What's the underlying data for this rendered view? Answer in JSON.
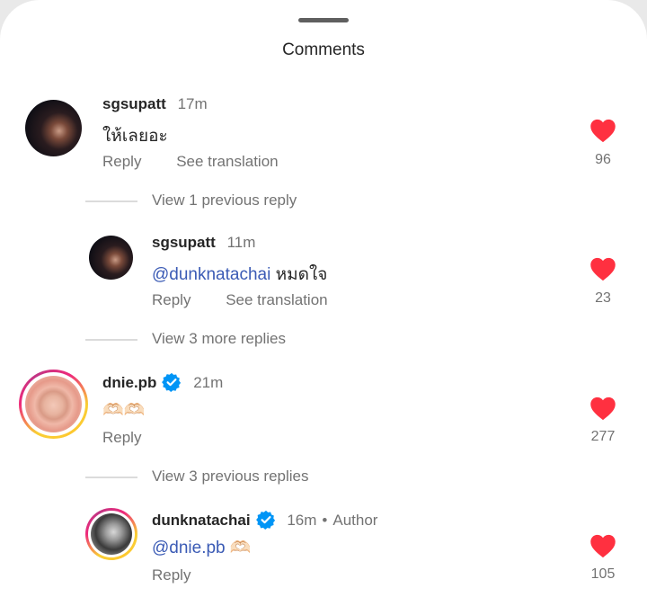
{
  "sheet": {
    "title": "Comments"
  },
  "comments": [
    {
      "username": "sgsupatt",
      "time": "17m",
      "text": "ให้เลยอะ",
      "reply": "Reply",
      "translate": "See translation",
      "likes": "96"
    },
    {
      "username": "sgsupatt",
      "time": "11m",
      "mention": "@dunknatachai",
      "text": "หมดใจ",
      "reply": "Reply",
      "translate": "See translation",
      "likes": "23"
    },
    {
      "username": "dnie.pb",
      "time": "21m",
      "text": "🫶🏻🫶🏻",
      "reply": "Reply",
      "likes": "277"
    },
    {
      "username": "dunknatachai",
      "time": "16m",
      "author": "Author",
      "mention": "@dnie.pb",
      "text": "🫶🏻",
      "reply": "Reply",
      "likes": "105"
    }
  ],
  "view_replies": {
    "first": "View 1 previous reply",
    "second": "View 3 more replies",
    "third": "View 3 previous replies"
  },
  "colors": {
    "heart": "#ff3040",
    "verified": "#0095f6",
    "mention": "#3b5bb5"
  },
  "icons": {
    "like": "heart-icon",
    "verified": "verified-badge-icon"
  }
}
